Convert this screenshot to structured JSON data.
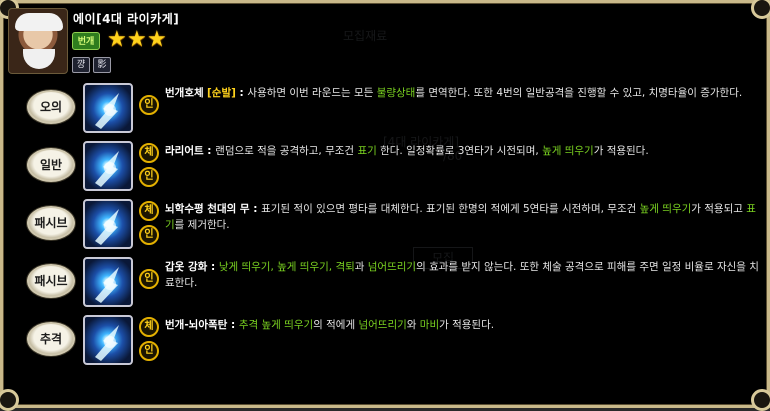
{
  "header": {
    "name": "에이[4대 라이카게]",
    "rank_badge": "번개",
    "stars": [
      "★",
      "★",
      "★"
    ],
    "tag_icons": [
      "꺙",
      "影"
    ]
  },
  "ghost": {
    "line1": "모집재료",
    "line2": "[4대 라이카게]",
    "line3": "/80",
    "button": "모집"
  },
  "skills": [
    {
      "category": "오의",
      "badges": [
        "인"
      ],
      "title": "번개호체",
      "title_suffix": "[순발]",
      "sep": " : ",
      "parts": [
        {
          "t": "사용하면 이번 라운드는 모든 "
        },
        {
          "t": "불량상태",
          "c": "green"
        },
        {
          "t": "를 면역한다. 또한 4번의 일반공격을 진행할 수 있고, 치명타율이 증가한다."
        }
      ]
    },
    {
      "category": "일반",
      "badges": [
        "체",
        "인"
      ],
      "title": "라리어트",
      "sep": " : ",
      "parts": [
        {
          "t": "랜덤으로 적을 공격하고, 무조건 "
        },
        {
          "t": "표기",
          "c": "green"
        },
        {
          "t": " 한다. 일정확률로 3연타가 시전되며, "
        },
        {
          "t": "높게 띄우기",
          "c": "green"
        },
        {
          "t": "가 적용된다."
        }
      ]
    },
    {
      "category": "패시브",
      "badges": [
        "체",
        "인"
      ],
      "title": "뇌학수평 천대의 무",
      "sep": " : ",
      "parts": [
        {
          "t": "표기된 적이 있으면 평타를 대체한다. 표기된 한명의 적에게 5연타를 시전하며, 무조건 "
        },
        {
          "t": "높게 띄우기",
          "c": "green"
        },
        {
          "t": "가 적용되고 "
        },
        {
          "t": "표기",
          "c": "green"
        },
        {
          "t": "를 제거한다."
        }
      ]
    },
    {
      "category": "패시브",
      "badges": [
        "인"
      ],
      "title": "갑옷 강화",
      "sep": " : ",
      "parts": [
        {
          "t": "낮게 띄우기, 높게 띄우기, 격퇴",
          "c": "green"
        },
        {
          "t": "과 "
        },
        {
          "t": "넘어뜨리기",
          "c": "green"
        },
        {
          "t": "의 효과를 받지 않는다. 또한 체술 공격으로 피해를 주면 일정 비율로 자신을 치료한다."
        }
      ]
    },
    {
      "category": "추격",
      "badges": [
        "체",
        "인"
      ],
      "title": "번개-뇌아폭탄",
      "sep": " : ",
      "parts": [
        {
          "t": "추격 높게 띄우기",
          "c": "green"
        },
        {
          "t": "의 적에게 "
        },
        {
          "t": "넘어뜨리기",
          "c": "green"
        },
        {
          "t": "와 "
        },
        {
          "t": "마비",
          "c": "green"
        },
        {
          "t": "가 적용된다."
        }
      ]
    }
  ]
}
